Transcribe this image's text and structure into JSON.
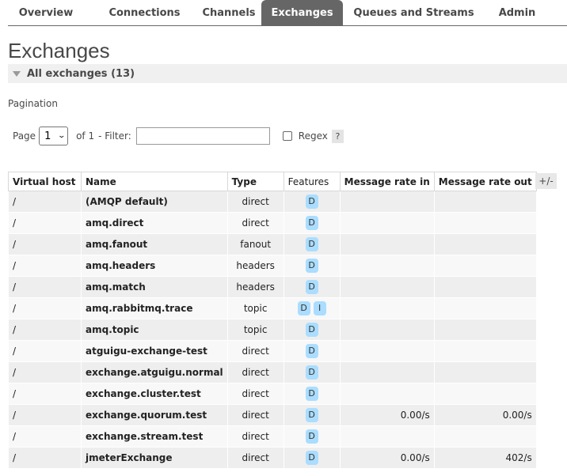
{
  "tabs": [
    {
      "label": "Overview"
    },
    {
      "label": "Connections"
    },
    {
      "label": "Channels"
    },
    {
      "label": "Exchanges",
      "active": true
    },
    {
      "label": "Queues and Streams"
    },
    {
      "label": "Admin"
    }
  ],
  "page_title": "Exchanges",
  "section_title": "All exchanges (13)",
  "pagination": {
    "label": "Pagination",
    "page_label": "Page",
    "page_value": "1",
    "of_label": "of 1",
    "filter_label": "- Filter:",
    "filter_value": "",
    "regex_label": "Regex",
    "help_label": "?"
  },
  "table": {
    "headers": {
      "vhost": "Virtual host",
      "name": "Name",
      "type": "Type",
      "features": "Features",
      "rate_in": "Message rate in",
      "rate_out": "Message rate out",
      "toggle": "+/-"
    },
    "rows": [
      {
        "vhost": "/",
        "name": "(AMQP default)",
        "type": "direct",
        "features": [
          "D"
        ],
        "rate_in": "",
        "rate_out": ""
      },
      {
        "vhost": "/",
        "name": "amq.direct",
        "type": "direct",
        "features": [
          "D"
        ],
        "rate_in": "",
        "rate_out": ""
      },
      {
        "vhost": "/",
        "name": "amq.fanout",
        "type": "fanout",
        "features": [
          "D"
        ],
        "rate_in": "",
        "rate_out": ""
      },
      {
        "vhost": "/",
        "name": "amq.headers",
        "type": "headers",
        "features": [
          "D"
        ],
        "rate_in": "",
        "rate_out": ""
      },
      {
        "vhost": "/",
        "name": "amq.match",
        "type": "headers",
        "features": [
          "D"
        ],
        "rate_in": "",
        "rate_out": ""
      },
      {
        "vhost": "/",
        "name": "amq.rabbitmq.trace",
        "type": "topic",
        "features": [
          "D",
          "I"
        ],
        "rate_in": "",
        "rate_out": ""
      },
      {
        "vhost": "/",
        "name": "amq.topic",
        "type": "topic",
        "features": [
          "D"
        ],
        "rate_in": "",
        "rate_out": ""
      },
      {
        "vhost": "/",
        "name": "atguigu-exchange-test",
        "type": "direct",
        "features": [
          "D"
        ],
        "rate_in": "",
        "rate_out": ""
      },
      {
        "vhost": "/",
        "name": "exchange.atguigu.normal",
        "type": "direct",
        "features": [
          "D"
        ],
        "rate_in": "",
        "rate_out": ""
      },
      {
        "vhost": "/",
        "name": "exchange.cluster.test",
        "type": "direct",
        "features": [
          "D"
        ],
        "rate_in": "",
        "rate_out": ""
      },
      {
        "vhost": "/",
        "name": "exchange.quorum.test",
        "type": "direct",
        "features": [
          "D"
        ],
        "rate_in": "0.00/s",
        "rate_out": "0.00/s"
      },
      {
        "vhost": "/",
        "name": "exchange.stream.test",
        "type": "direct",
        "features": [
          "D"
        ],
        "rate_in": "",
        "rate_out": ""
      },
      {
        "vhost": "/",
        "name": "jmeterExchange",
        "type": "direct",
        "features": [
          "D"
        ],
        "rate_in": "0.00/s",
        "rate_out": "402/s"
      }
    ]
  },
  "colors": {
    "active_tab": "#666666",
    "badge": "#aaddff",
    "row_odd": "#eeeeee",
    "row_even": "#f8f8f8"
  }
}
